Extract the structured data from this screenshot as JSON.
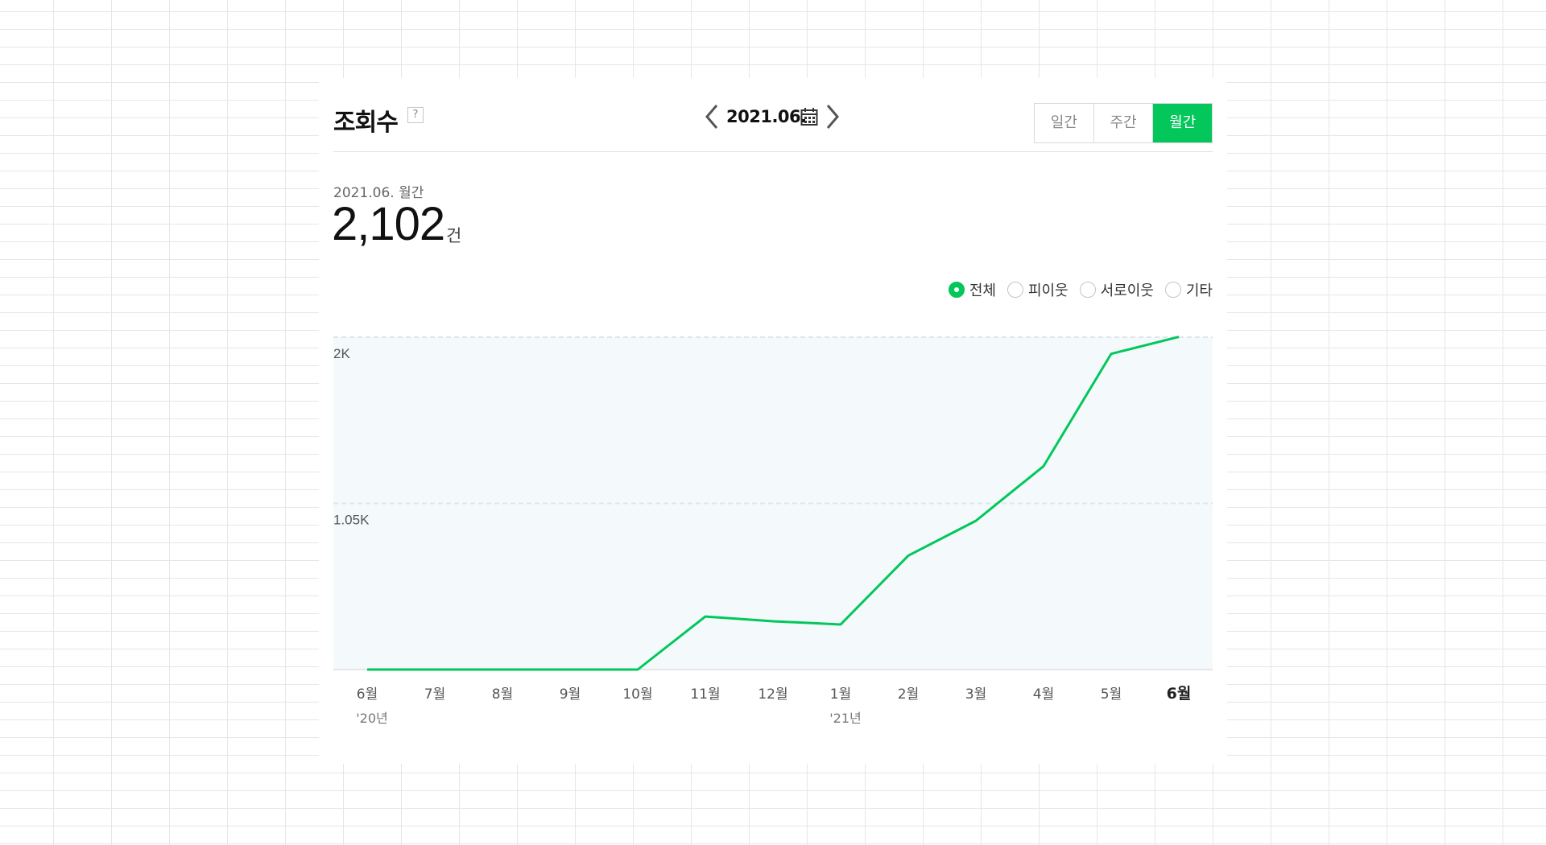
{
  "colors": {
    "accent": "#03c75a",
    "plot_bg": "#f4fafc",
    "grid": "#dde6ea"
  },
  "header": {
    "title": "조회수",
    "help_label": "?",
    "date": "2021.06.",
    "prev_icon": "chevron-left-icon",
    "next_icon": "chevron-right-icon",
    "calendar_icon": "calendar-icon",
    "tabs": [
      {
        "label": "일간",
        "active": false
      },
      {
        "label": "주간",
        "active": false
      },
      {
        "label": "월간",
        "active": true
      }
    ]
  },
  "summary": {
    "period_label": "2021.06. 월간",
    "total": "2,102",
    "unit": "건"
  },
  "filters": [
    {
      "label": "전체",
      "checked": true
    },
    {
      "label": "피이웃",
      "checked": false
    },
    {
      "label": "서로이웃",
      "checked": false
    },
    {
      "label": "기타",
      "checked": false
    }
  ],
  "chart_data": {
    "type": "area",
    "x_labels": [
      "6월",
      "7월",
      "8월",
      "9월",
      "10월",
      "11월",
      "12월",
      "1월",
      "2월",
      "3월",
      "4월",
      "5월",
      "6월"
    ],
    "year_labels": [
      {
        "index": 0,
        "label": "'20년"
      },
      {
        "index": 7,
        "label": "'21년"
      }
    ],
    "highlight_index": 12,
    "values": [
      0,
      0,
      0,
      0,
      0,
      335,
      305,
      285,
      720,
      940,
      1285,
      1995,
      2102
    ],
    "y_ticks": [
      {
        "value": 1050,
        "label": "1.05K"
      },
      {
        "value": 2100,
        "label": "2K"
      }
    ],
    "ylim": [
      0,
      2100
    ],
    "grid": true
  }
}
